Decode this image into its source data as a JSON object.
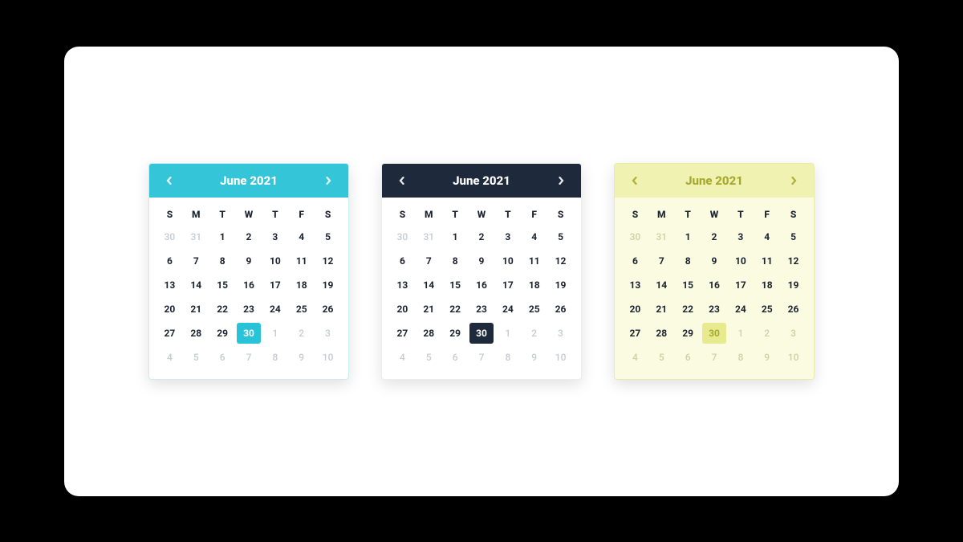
{
  "dow": [
    "S",
    "M",
    "T",
    "W",
    "T",
    "F",
    "S"
  ],
  "trailing": [
    30,
    31
  ],
  "days_in_month": 30,
  "leading": [
    1,
    2,
    3,
    4,
    5,
    6,
    7,
    8,
    9,
    10
  ],
  "selected_day": 30,
  "calendars": [
    {
      "title": "June 2021",
      "theme": "theme0",
      "selClass": "c0"
    },
    {
      "title": "June 2021",
      "theme": "theme1",
      "selClass": "c1"
    },
    {
      "title": "June 2021",
      "theme": "theme2",
      "selClass": "c2"
    }
  ]
}
